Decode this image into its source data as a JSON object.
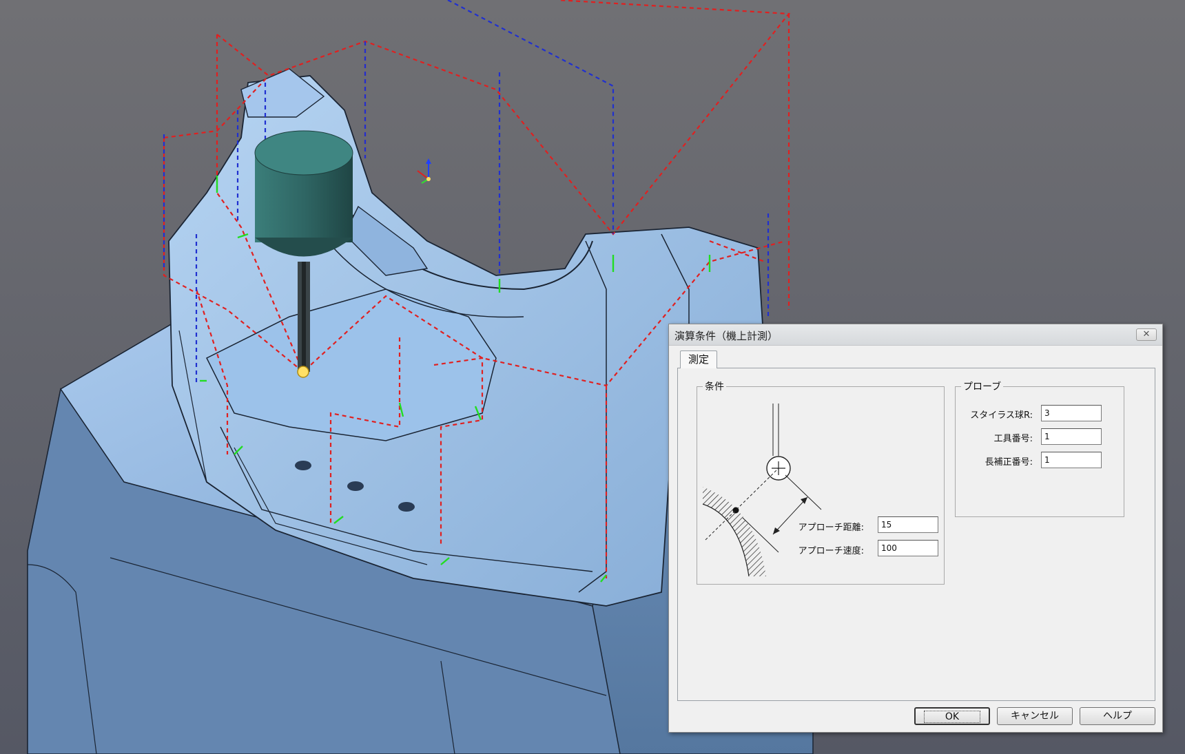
{
  "dialog": {
    "title": "演算条件（機上計測）",
    "close_icon": "close-icon",
    "tab_label": "測定",
    "conditions": {
      "group_title": "条件",
      "approach_distance_label": "アプローチ距離:",
      "approach_distance_value": "15",
      "approach_speed_label": "アプローチ速度:",
      "approach_speed_value": "100"
    },
    "probe": {
      "group_title": "プローブ",
      "stylus_radius_label": "スタイラス球R:",
      "stylus_radius_value": "3",
      "tool_number_label": "工具番号:",
      "tool_number_value": "1",
      "length_offset_label": "長補正番号:",
      "length_offset_value": "1"
    },
    "buttons": {
      "ok": "OK",
      "cancel": "キャンセル",
      "help": "ヘルプ"
    }
  },
  "viewport": {
    "background_top": "#6e6e72",
    "background_bottom": "#5a5a66",
    "part_color": "#7ba2cc",
    "path_red": "#e02020",
    "path_blue": "#2030d0",
    "probe_color": "#2e6a68",
    "axis_icon": "axis-triad-icon"
  }
}
